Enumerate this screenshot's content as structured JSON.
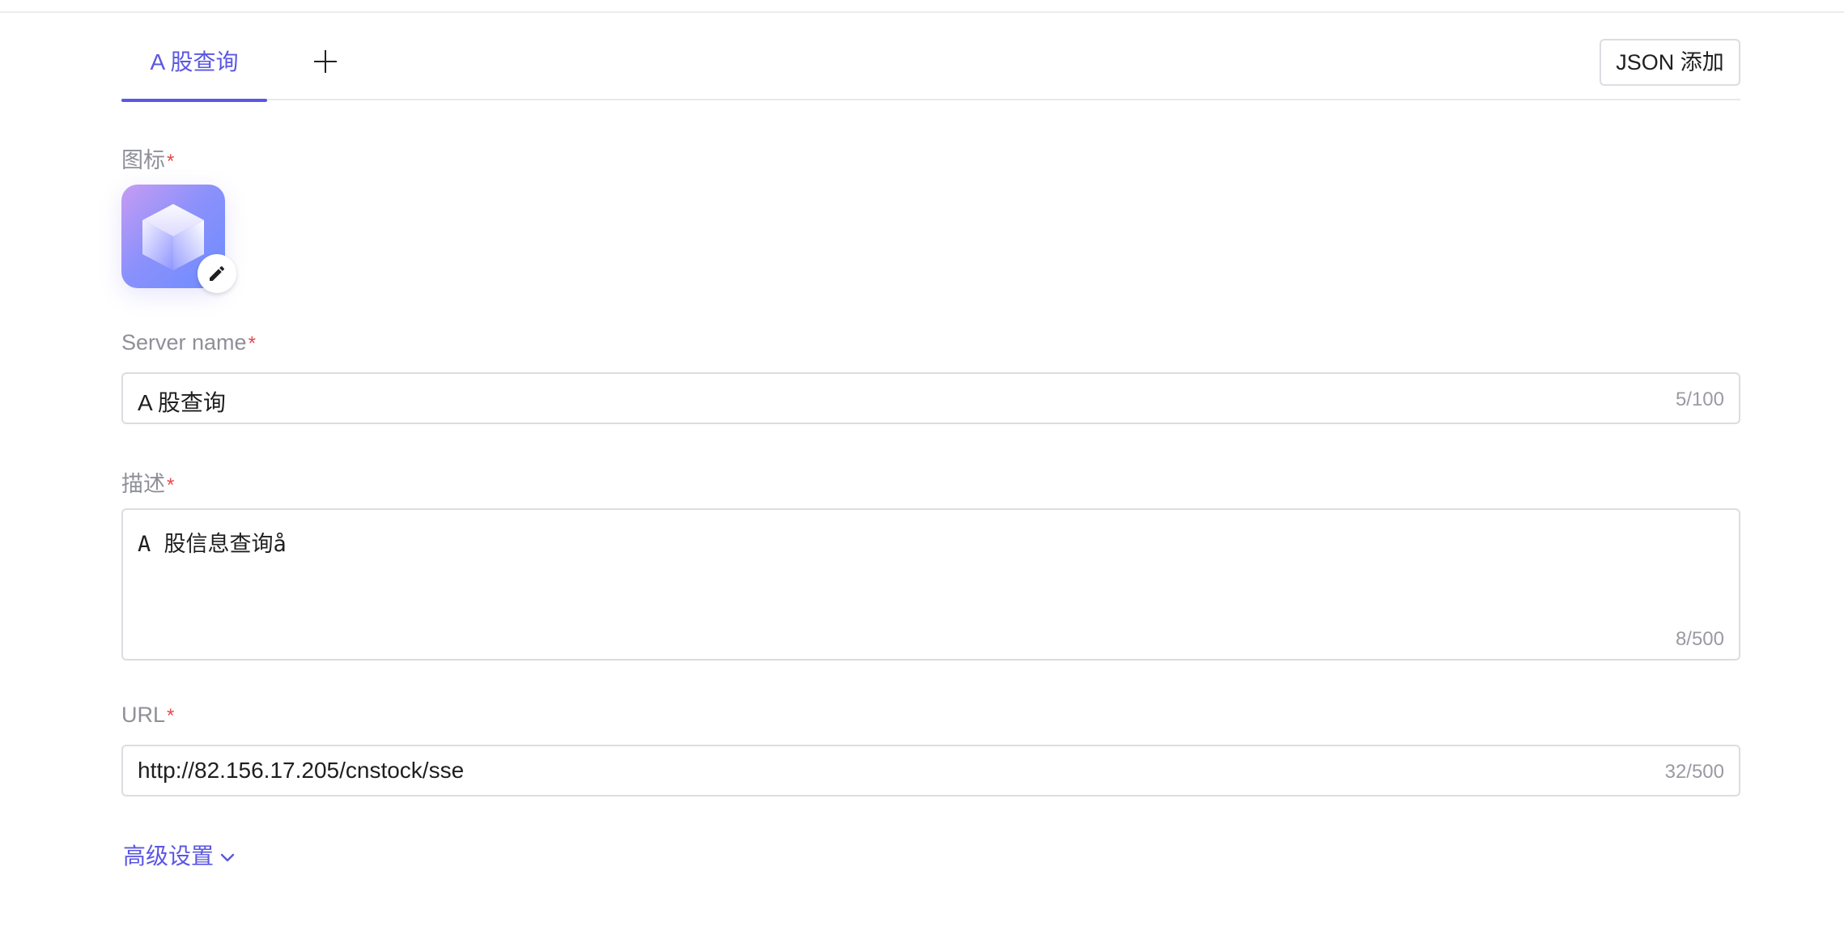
{
  "tabs": [
    {
      "label": "A 股查询",
      "active": true
    }
  ],
  "header": {
    "json_add_label": "JSON 添加"
  },
  "form": {
    "icon_label": "图标",
    "server_name_label": "Server name",
    "server_name_value": "A 股查询",
    "server_name_count": "5/100",
    "description_label": "描述",
    "description_value": "A 股信息查询å",
    "description_count": "8/500",
    "url_label": "URL",
    "url_value": "http://82.156.17.205/cnstock/sse",
    "url_count": "32/500",
    "required_mark": "*",
    "advanced_label": "高级设置"
  },
  "colors": {
    "accent": "#5b57e3",
    "required": "#e5484d"
  },
  "icons": [
    "plus-icon",
    "cube-icon",
    "pencil-icon",
    "chevron-down-icon"
  ]
}
